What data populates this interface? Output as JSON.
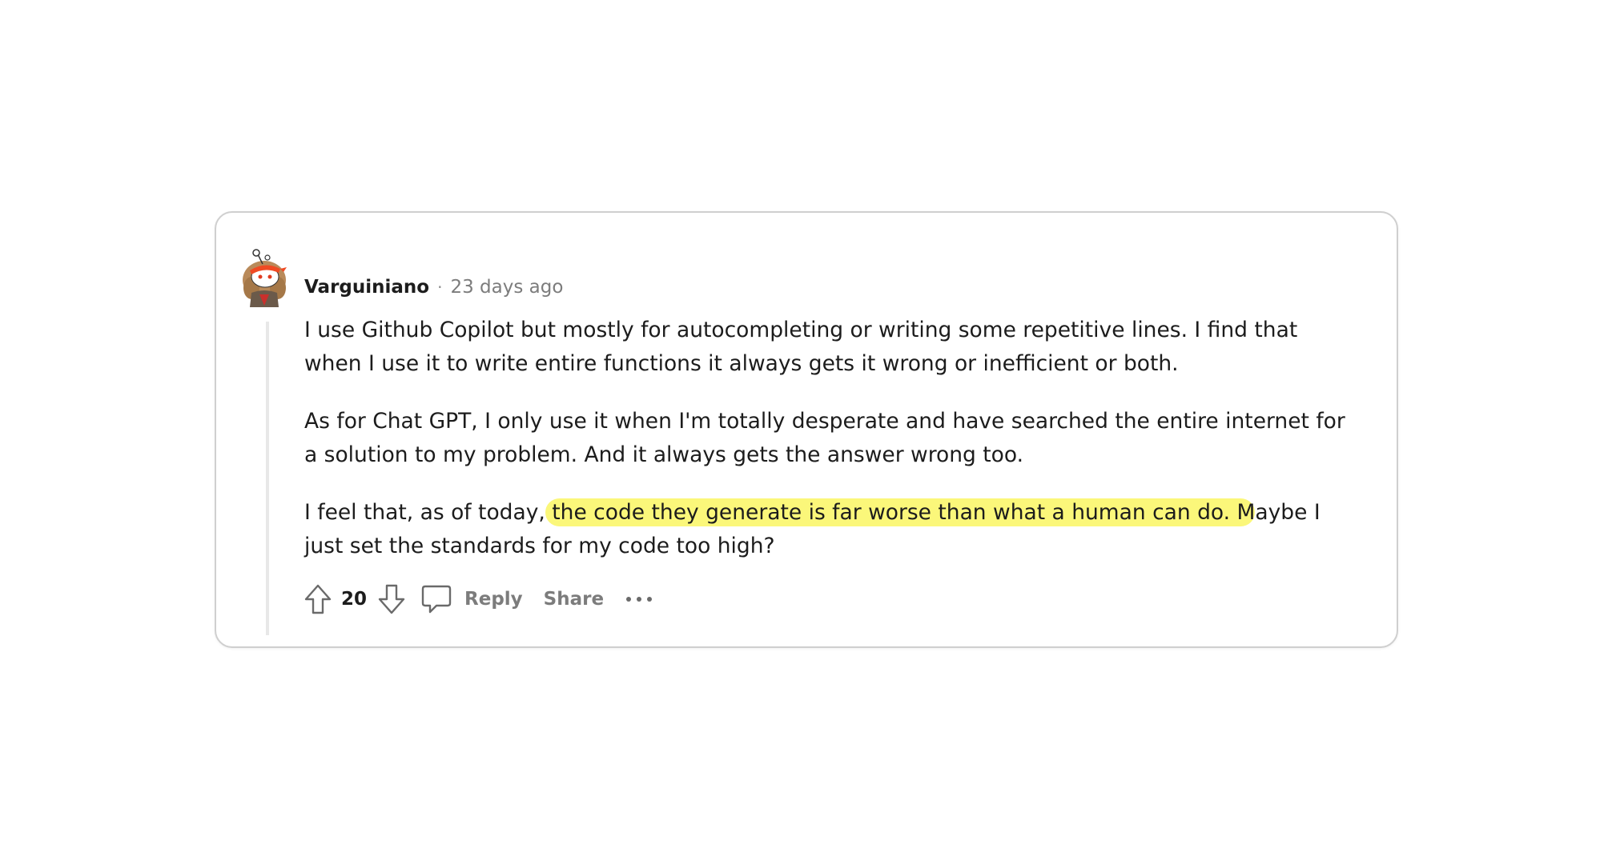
{
  "comment": {
    "username": "Varguiniano",
    "separator": "·",
    "timestamp": "23 days ago",
    "paragraphs": {
      "p1": "I use Github Copilot but mostly for autocompleting or writing some repetitive lines. I find that when I use it to write entire functions it always gets it wrong or inefficient or both.",
      "p2": "As for Chat GPT, I only use it when I'm totally desperate and have searched the entire internet for a solution to my problem. And it always gets the answer wrong too.",
      "p3_before": "I feel that, as of today,",
      "p3_highlight": " the code they generate is far worse than what a human can do. M",
      "p3_after": "aybe I just set the standards for my code too high?"
    },
    "highlight_color": "#fbf77a",
    "avatar_icon": "snoo-avatar-icon"
  },
  "actions": {
    "upvote_icon": "upvote-arrow-icon",
    "vote_count": "20",
    "downvote_icon": "downvote-arrow-icon",
    "reply_icon": "speech-bubble-icon",
    "reply_label": "Reply",
    "share_label": "Share",
    "more_icon": "ellipsis-icon"
  }
}
